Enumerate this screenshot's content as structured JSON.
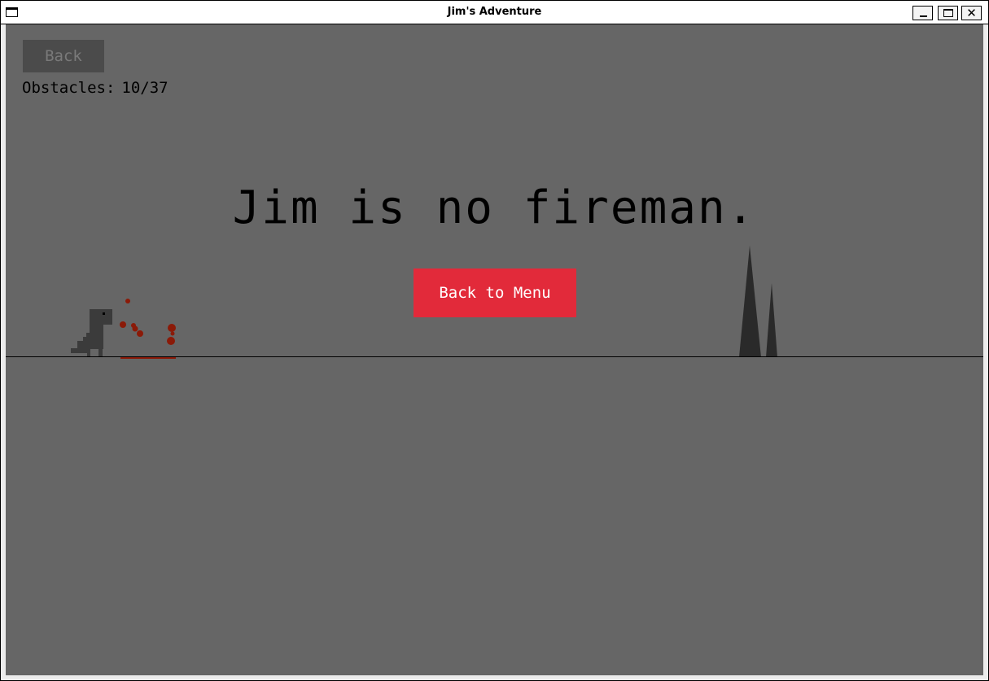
{
  "window": {
    "title": "Jim's Adventure"
  },
  "game": {
    "back_label": "Back",
    "obstacles_label": "Obstacles:",
    "obstacles_cleared": 10,
    "obstacles_total": 37,
    "obstacles_text": "10/37",
    "message": "Jim is no fireman.",
    "menu_button_label": "Back to Menu"
  },
  "colors": {
    "background": "#666666",
    "menu_button": "#e22a3a",
    "dino": "#3b3b3b",
    "spikes": "#2a2a2a",
    "blood": "#8b1a08"
  },
  "icons": [
    "app-icon",
    "minimize-icon",
    "maximize-icon",
    "close-icon",
    "dinosaur-sprite",
    "spike-obstacle",
    "blood-splatter"
  ]
}
